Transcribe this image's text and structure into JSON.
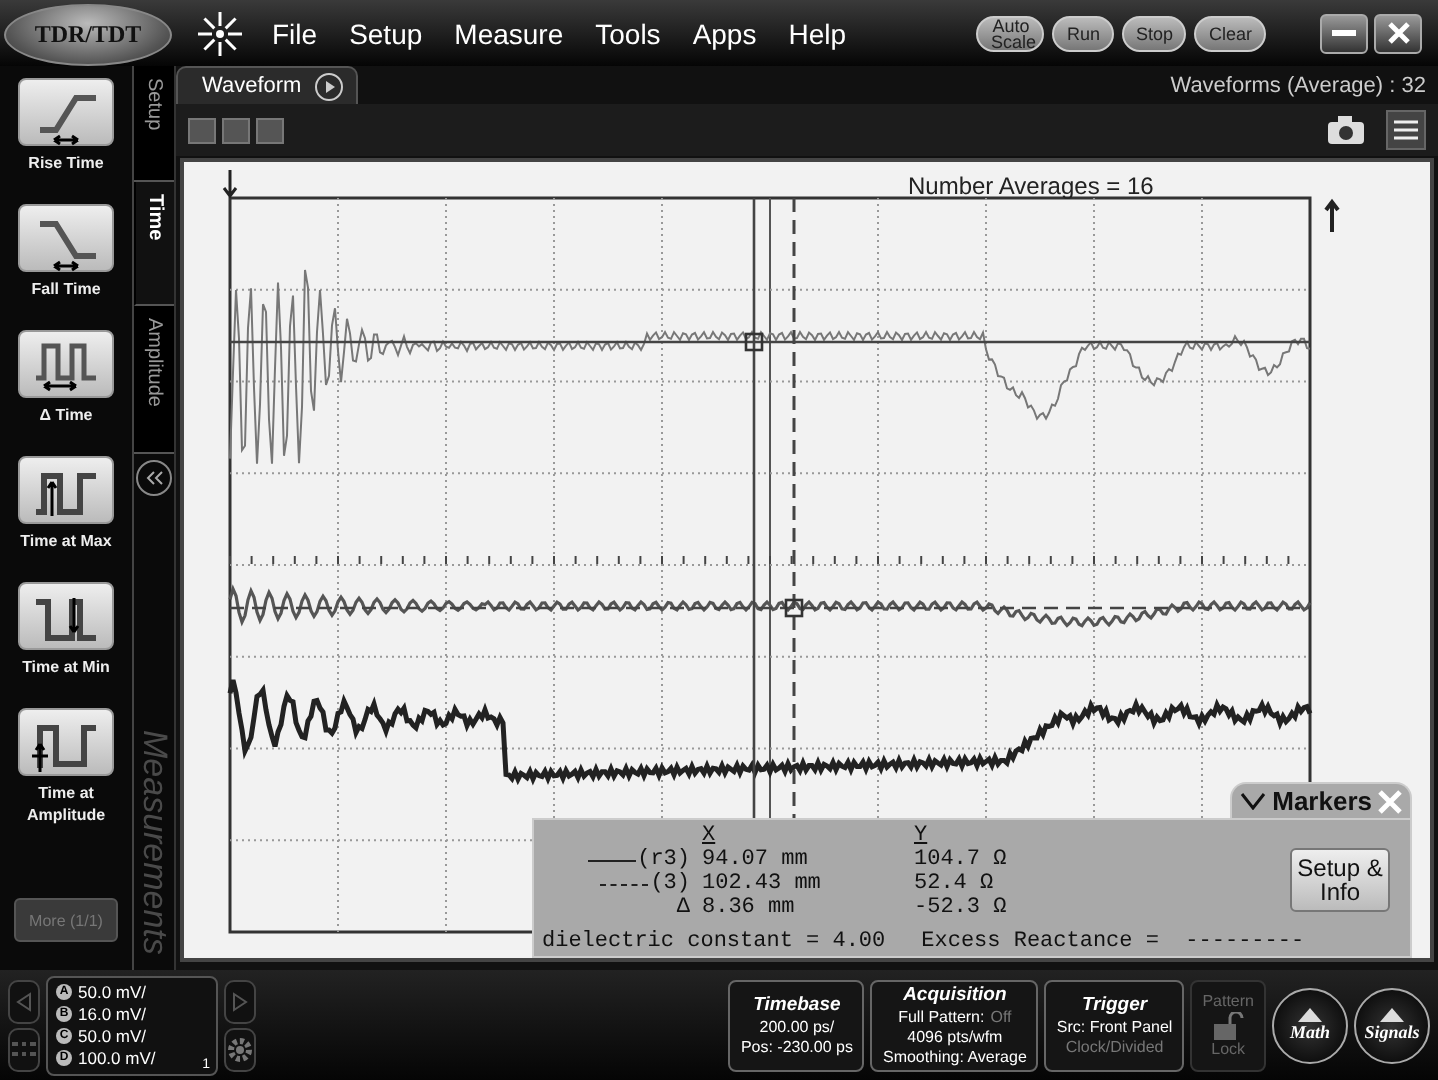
{
  "app_button": {
    "label": "TDR/TDT"
  },
  "menu": [
    "File",
    "Setup",
    "Measure",
    "Tools",
    "Apps",
    "Help"
  ],
  "run_controls": [
    "Auto Scale",
    "Run",
    "Stop",
    "Clear"
  ],
  "view_tab": {
    "label": "Waveform",
    "selected": true
  },
  "waveform_count": "Waveforms (Average) : 32",
  "side_tabs": [
    {
      "label": "Setup",
      "selected": false
    },
    {
      "label": "Time",
      "selected": true
    },
    {
      "label": "Amplitude",
      "selected": false
    }
  ],
  "side_title": "Measurements",
  "measurements": [
    {
      "label": "Rise Time",
      "kind": "rise"
    },
    {
      "label": "Fall Time",
      "kind": "fall"
    },
    {
      "label": "Δ Time",
      "kind": "delta"
    },
    {
      "label": "Time at Max",
      "kind": "max"
    },
    {
      "label": "Time at Min",
      "kind": "min"
    },
    {
      "label": "Time at Amplitude",
      "kind": "amplitude"
    }
  ],
  "more_button": {
    "label": "More (1/1)",
    "disabled": true
  },
  "plot": {
    "annotation": "Number Averages = 16"
  },
  "markers": {
    "title": "Markers",
    "header_x": "X",
    "header_y": "Y",
    "rows": [
      {
        "kind": "solid",
        "label": "(r3)",
        "x": "94.07 mm",
        "y": "104.7 Ω"
      },
      {
        "kind": "dashed",
        "label": "(3)",
        "x": "102.43 mm",
        "y": "52.4 Ω"
      },
      {
        "kind": "delta",
        "label": "Δ",
        "x": "8.36 mm",
        "y": "-52.3 Ω"
      }
    ],
    "footer_left": "dielectric constant = 4.00",
    "footer_right": "Excess Reactance =  ---------",
    "button": "Setup & Info"
  },
  "channels": [
    {
      "badge": "A",
      "scale": "50.0 mV/"
    },
    {
      "badge": "B",
      "scale": "16.0 mV/"
    },
    {
      "badge": "C",
      "scale": "50.0 mV/"
    },
    {
      "badge": "D",
      "scale": "100.0 mV/"
    }
  ],
  "channel_page": "1",
  "settings": [
    {
      "title": "Timebase",
      "lines": [
        [
          {
            "text": "200.00 ps/",
            "dim": false
          }
        ],
        [
          {
            "text": "Pos: -230.00 ps",
            "dim": false
          }
        ]
      ]
    },
    {
      "title": "Acquisition",
      "lines": [
        [
          {
            "text": "Full Pattern:",
            "dim": false
          },
          {
            "text": "Off",
            "dim": true
          }
        ],
        [
          {
            "text": "4096 pts/wfm",
            "dim": false
          }
        ],
        [
          {
            "text": "Smoothing: Average",
            "dim": false
          }
        ]
      ]
    },
    {
      "title": "Trigger",
      "lines": [
        [
          {
            "text": "Src: Front Panel",
            "dim": false
          }
        ],
        [
          {
            "text": "Clock/Divided",
            "dim": true
          }
        ]
      ]
    }
  ],
  "pattern": {
    "title": "Pattern",
    "label": "Lock",
    "disabled": true
  },
  "round_buttons": [
    "Math",
    "Signals"
  ]
}
